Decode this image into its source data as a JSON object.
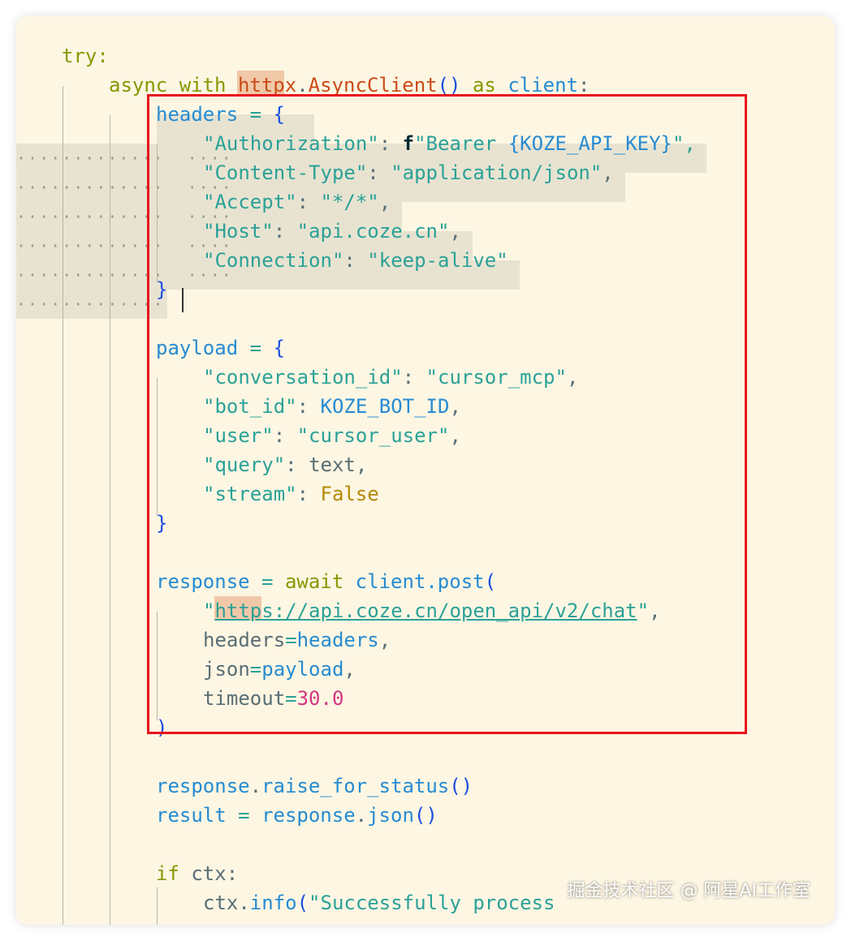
{
  "editor": {
    "language": "python",
    "theme_background": "#fdf6e3",
    "selection_color": "#e8e3d1",
    "annotation_box_color": "#e8141b"
  },
  "code": {
    "try_kw": "try:",
    "async_with": "async with",
    "httpx": "httpx",
    "dot": ".",
    "async_client": "AsyncClient",
    "parens": "()",
    "as": "as",
    "client_var": "client",
    "colon": ":",
    "headers_var": "headers",
    "assign": " = ",
    "open_brace": "{",
    "close_brace": "}",
    "auth_key": "\"Authorization\"",
    "kv_sep": ": ",
    "f_prefix": "f",
    "bearer_str": "\"Bearer ",
    "interp": "{KOZE_API_KEY}",
    "close_quote_comma": "\",",
    "ct_key": "\"Content-Type\"",
    "ct_val": "\"application/json\"",
    "comma": ",",
    "accept_key": "\"Accept\"",
    "accept_val": "\"*/*\"",
    "host_key": "\"Host\"",
    "host_val": "\"api.coze.cn\"",
    "conn_key": "\"Connection\"",
    "conn_val": "\"keep-alive\"",
    "payload_var": "payload",
    "conv_key": "\"conversation_id\"",
    "conv_val": "\"cursor_mcp\"",
    "bot_key": "\"bot_id\"",
    "bot_val": "KOZE_BOT_ID",
    "user_key": "\"user\"",
    "user_val": "\"cursor_user\"",
    "query_key": "\"query\"",
    "query_val": "text",
    "stream_key": "\"stream\"",
    "stream_val": "False",
    "response_var": "response",
    "await_kw": "await",
    "client_post": "client.post",
    "open_paren": "(",
    "close_paren": ")",
    "quote": "\"",
    "url_http": "http",
    "url_rest": "s://api.coze.cn/open_api/v2/chat",
    "headers_kw": "headers",
    "eq": "=",
    "json_kw": "json",
    "payload_ref": "payload",
    "timeout_kw": "timeout",
    "timeout_val": "30.0",
    "raise_call": "raise_for_status",
    "result_var": "result",
    "json_call": "json",
    "if_kw": "if",
    "ctx_cond": " ctx:",
    "ctx": "ctx.",
    "info": "info",
    "success_str": "\"Successfully process"
  },
  "watermark": "掘金技术社区 @ 阿星AI工作室"
}
